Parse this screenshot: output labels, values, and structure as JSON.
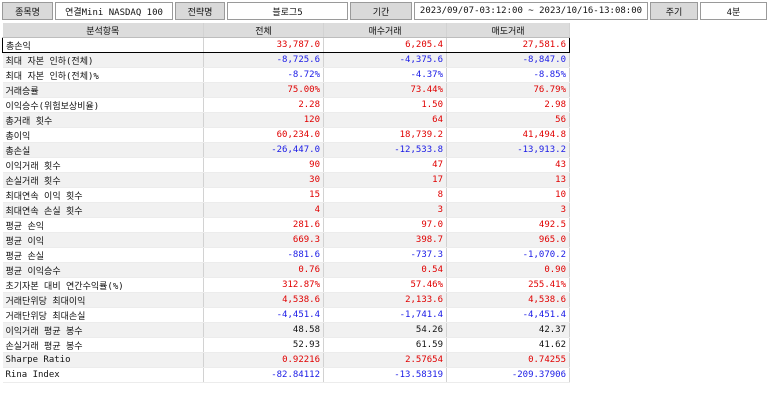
{
  "info_bar": {
    "item_label": "종목명",
    "item_value": "연결Mini NASDAQ 100",
    "strategy_label": "전략명",
    "strategy_value": "블로그5",
    "period_label": "기간",
    "period_value": "2023/09/07-03:12:00 ~ 2023/10/16-13:08:00",
    "cycle_label": "주기",
    "cycle_value": "4분"
  },
  "table": {
    "headers": [
      "분석항목",
      "전체",
      "매수거래",
      "매도거래"
    ],
    "rows": [
      {
        "label": "총손익",
        "values": [
          "33,787.0",
          "6,205.4",
          "27,581.6"
        ],
        "colors": [
          "red",
          "red",
          "red"
        ]
      },
      {
        "label": "최대 자본 인하(전체)",
        "values": [
          "-8,725.6",
          "-4,375.6",
          "-8,847.0"
        ],
        "colors": [
          "blue",
          "blue",
          "blue"
        ]
      },
      {
        "label": "최대 자본 인하(전체)%",
        "values": [
          "-8.72%",
          "-4.37%",
          "-8.85%"
        ],
        "colors": [
          "blue",
          "blue",
          "blue"
        ]
      },
      {
        "label": "거래승률",
        "values": [
          "75.00%",
          "73.44%",
          "76.79%"
        ],
        "colors": [
          "red",
          "red",
          "red"
        ]
      },
      {
        "label": "이익승수(위험보상비율)",
        "values": [
          "2.28",
          "1.50",
          "2.98"
        ],
        "colors": [
          "red",
          "red",
          "red"
        ]
      },
      {
        "label": "총거래 횟수",
        "values": [
          "120",
          "64",
          "56"
        ],
        "colors": [
          "red",
          "red",
          "red"
        ]
      },
      {
        "label": "총이익",
        "values": [
          "60,234.0",
          "18,739.2",
          "41,494.8"
        ],
        "colors": [
          "red",
          "red",
          "red"
        ]
      },
      {
        "label": "총손실",
        "values": [
          "-26,447.0",
          "-12,533.8",
          "-13,913.2"
        ],
        "colors": [
          "blue",
          "blue",
          "blue"
        ]
      },
      {
        "label": "이익거래 횟수",
        "values": [
          "90",
          "47",
          "43"
        ],
        "colors": [
          "red",
          "red",
          "red"
        ]
      },
      {
        "label": "손실거래 횟수",
        "values": [
          "30",
          "17",
          "13"
        ],
        "colors": [
          "red",
          "red",
          "red"
        ]
      },
      {
        "label": "최대연속 이익 횟수",
        "values": [
          "15",
          "8",
          "10"
        ],
        "colors": [
          "red",
          "red",
          "red"
        ]
      },
      {
        "label": "최대연속 손실 횟수",
        "values": [
          "4",
          "3",
          "3"
        ],
        "colors": [
          "red",
          "red",
          "red"
        ]
      },
      {
        "label": "평균 손익",
        "values": [
          "281.6",
          "97.0",
          "492.5"
        ],
        "colors": [
          "red",
          "red",
          "red"
        ]
      },
      {
        "label": "평균 이익",
        "values": [
          "669.3",
          "398.7",
          "965.0"
        ],
        "colors": [
          "red",
          "red",
          "red"
        ]
      },
      {
        "label": "평균 손실",
        "values": [
          "-881.6",
          "-737.3",
          "-1,070.2"
        ],
        "colors": [
          "blue",
          "blue",
          "blue"
        ]
      },
      {
        "label": "평균 이익승수",
        "values": [
          "0.76",
          "0.54",
          "0.90"
        ],
        "colors": [
          "red",
          "red",
          "red"
        ]
      },
      {
        "label": "초기자본 대비 연간수익률(%)",
        "values": [
          "312.87%",
          "57.46%",
          "255.41%"
        ],
        "colors": [
          "red",
          "red",
          "red"
        ]
      },
      {
        "label": "거래단위당 최대이익",
        "values": [
          "4,538.6",
          "2,133.6",
          "4,538.6"
        ],
        "colors": [
          "red",
          "red",
          "red"
        ]
      },
      {
        "label": "거래단위당 최대손실",
        "values": [
          "-4,451.4",
          "-1,741.4",
          "-4,451.4"
        ],
        "colors": [
          "blue",
          "blue",
          "blue"
        ]
      },
      {
        "label": "이익거래 평균 봉수",
        "values": [
          "48.58",
          "54.26",
          "42.37"
        ],
        "colors": [
          "black",
          "black",
          "black"
        ]
      },
      {
        "label": "손실거래 평균 봉수",
        "values": [
          "52.93",
          "61.59",
          "41.62"
        ],
        "colors": [
          "black",
          "black",
          "black"
        ]
      },
      {
        "label": "Sharpe Ratio",
        "values": [
          "0.92216",
          "2.57654",
          "0.74255"
        ],
        "colors": [
          "red",
          "red",
          "red"
        ]
      },
      {
        "label": "Rina Index",
        "values": [
          "-82.84112",
          "-13.58319",
          "-209.37906"
        ],
        "colors": [
          "blue",
          "blue",
          "blue"
        ]
      }
    ]
  },
  "colors": {
    "positive": "#e00000",
    "negative": "#1a1ae6",
    "neutral": "#111111",
    "header_bg": "#dcdcdc",
    "alt_row_bg": "#f1f1f1"
  }
}
